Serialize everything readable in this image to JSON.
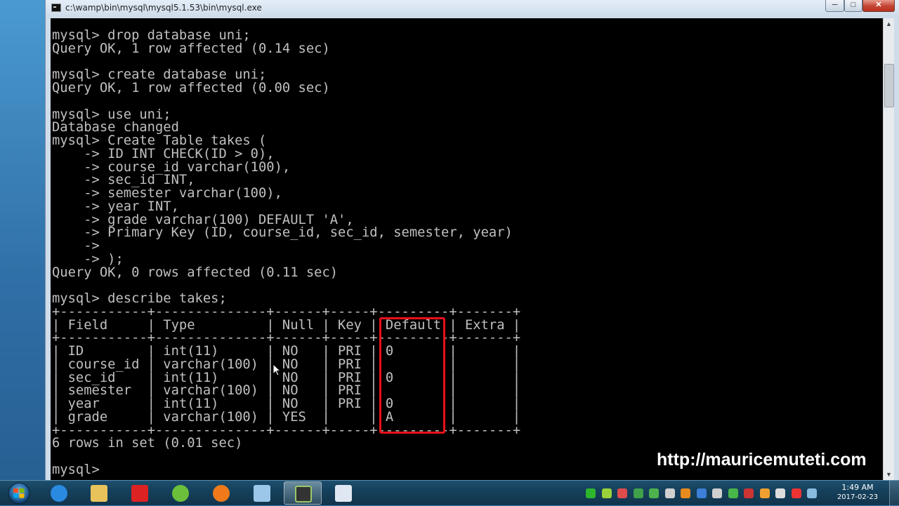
{
  "window": {
    "title": "c:\\wamp\\bin\\mysql\\mysql5.1.53\\bin\\mysql.exe",
    "min_label": "─",
    "max_label": "□",
    "close_label": "✕"
  },
  "console": {
    "lines": [
      "mysql> drop database uni;",
      "Query OK, 1 row affected (0.14 sec)",
      "",
      "mysql> create database uni;",
      "Query OK, 1 row affected (0.00 sec)",
      "",
      "mysql> use uni;",
      "Database changed",
      "mysql> Create Table takes (",
      "    -> ID INT CHECK(ID > 0),",
      "    -> course_id varchar(100),",
      "    -> sec_id INT,",
      "    -> semester varchar(100),",
      "    -> year INT,",
      "    -> grade varchar(100) DEFAULT 'A',",
      "    -> Primary Key (ID, course_id, sec_id, semester, year)",
      "    ->",
      "    -> );",
      "Query OK, 0 rows affected (0.11 sec)",
      "",
      "mysql> describe takes;",
      "+-----------+--------------+------+-----+---------+-------+",
      "| Field     | Type         | Null | Key | Default | Extra |",
      "+-----------+--------------+------+-----+---------+-------+",
      "| ID        | int(11)      | NO   | PRI | 0       |       |",
      "| course_id | varchar(100) | NO   | PRI |         |       |",
      "| sec_id    | int(11)      | NO   | PRI | 0       |       |",
      "| semester  | varchar(100) | NO   | PRI |         |       |",
      "| year      | int(11)      | NO   | PRI | 0       |       |",
      "| grade     | varchar(100) | YES  |     | A       |       |",
      "+-----------+--------------+------+-----+---------+-------+",
      "6 rows in set (0.01 sec)",
      "",
      "mysql>"
    ]
  },
  "watermark": "http://mauricemuteti.com",
  "taskbar": {
    "items": [
      {
        "name": "internet-explorer-icon",
        "color": "#2a8ae0"
      },
      {
        "name": "folder-icon",
        "color": "#e8c35a"
      },
      {
        "name": "app-red-icon",
        "color": "#d22"
      },
      {
        "name": "utorrent-icon",
        "color": "#6bbf3a"
      },
      {
        "name": "firefox-icon",
        "color": "#f07a1a"
      },
      {
        "name": "notepad-icon",
        "color": "#9cc7e8"
      },
      {
        "name": "mysql-console-icon",
        "color": "#333",
        "active": true
      },
      {
        "name": "window-app-icon",
        "color": "#dfe8f2"
      }
    ],
    "tray_colors": [
      "#2db52d",
      "#9ad13a",
      "#e04b4b",
      "#3fa14a",
      "#4db34d",
      "#d0d0d0",
      "#e88b1e",
      "#3b7fd9",
      "#cfcfcf",
      "#49b649",
      "#c33",
      "#f0a030",
      "#dddddd",
      "#e33",
      "#8bd"
    ],
    "clock_time": "1:49 AM",
    "clock_date": "2017-02-23"
  },
  "highlight_color": "#e8101a"
}
